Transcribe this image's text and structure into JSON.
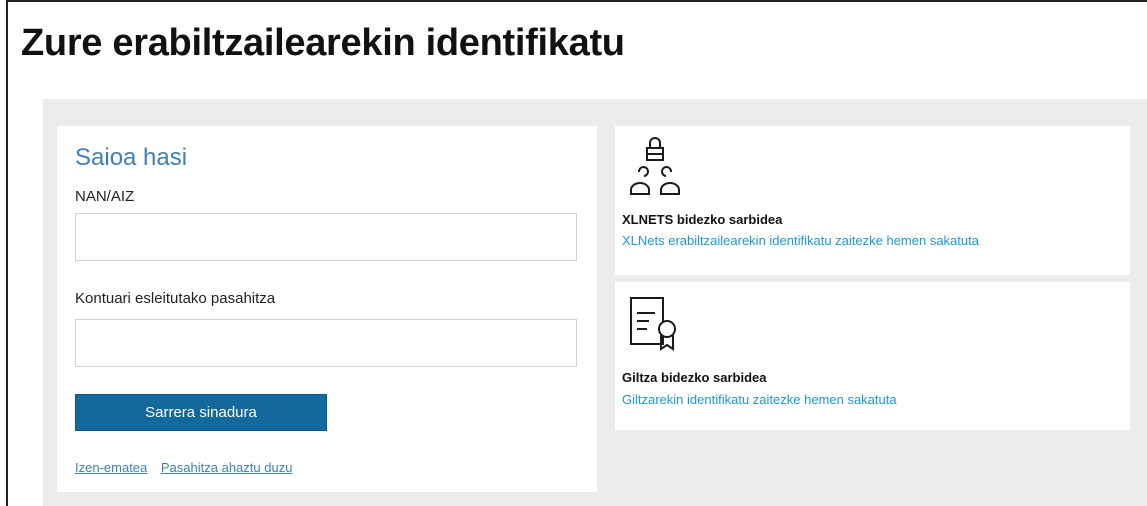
{
  "page": {
    "title": "Zure erabiltzailearekin identifikatu"
  },
  "login": {
    "heading": "Saioa hasi",
    "id_label": "NAN/AIZ",
    "id_value": "",
    "password_label": "Kontuari esleitutako pasahitza",
    "password_value": "",
    "submit_label": "Sarrera sinadura",
    "register_link": "Izen-ematea",
    "forgot_link": "Pasahitza ahaztu duzu"
  },
  "options": [
    {
      "icon": "users-lock-icon",
      "title": "XLNETS bidezko sarbidea",
      "link": "XLNets erabiltzailearekin identifikatu zaitezke hemen sakatuta"
    },
    {
      "icon": "certificate-icon",
      "title": "Giltza bidezko sarbidea",
      "link": "Giltzarekin identifikatu zaitezke hemen sakatuta"
    }
  ],
  "colors": {
    "heading_blue": "#3e80b4",
    "button_blue": "#13689c",
    "link_blue": "#1a9ad6",
    "gray_bg": "#ececec"
  }
}
